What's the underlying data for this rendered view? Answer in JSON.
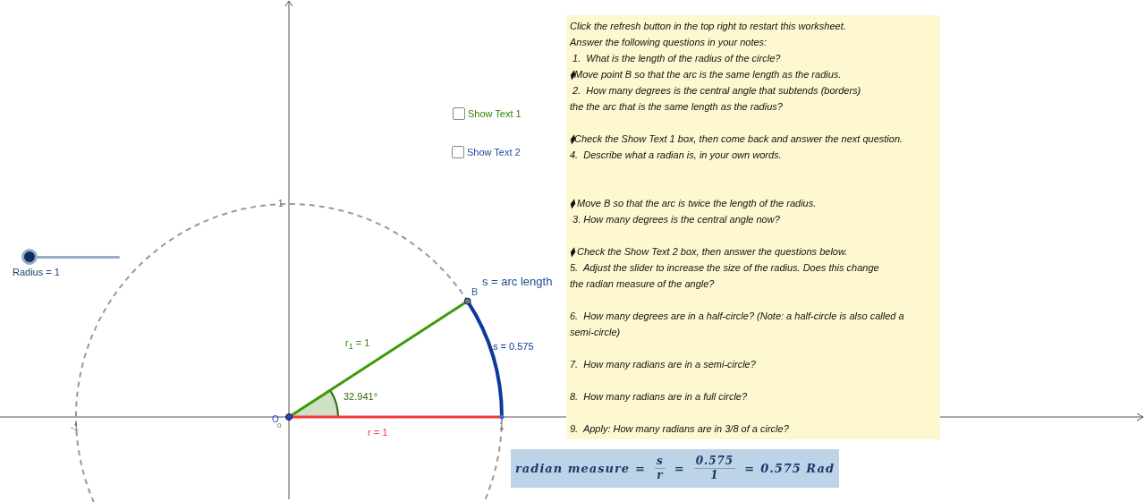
{
  "graphics": {
    "slider": {
      "label": "Radius = 1",
      "level": 0
    },
    "checkboxes": [
      {
        "label": "Show Text 1",
        "checked": false,
        "color": "#2e8500"
      },
      {
        "label": "Show Text 2",
        "checked": false,
        "color": "#1a4a9a"
      }
    ],
    "x_axis_ticks": [
      "-1",
      "0",
      "1"
    ],
    "y_axis_ticks": [
      "1"
    ],
    "point_labels": {
      "origin": "O",
      "b": "B"
    },
    "measure_labels": {
      "arc_caption": "s = arc length",
      "r1": "r$_{1}$ = 1",
      "arc": "s = 0.575",
      "angle": "32.941°",
      "r": "r = 1"
    }
  },
  "worksheet": {
    "paragraphs": [
      [
        "Click the refresh button in the top right to restart this worksheet.",
        "Answer the following questions in your notes:",
        " 1.  What is the length of the radius of the circle?",
        "⧫Move point B so that the arc is the same length as the radius.",
        " 2.  How many degrees is the central angle that subtends (borders)",
        "the the arc that is the same length as the radius?"
      ],
      [
        "⧫Check the Show Text 1 box, then come back and answer the next question.",
        "4.  Describe what a radian is, in your own words."
      ],
      [
        "⧫ Move B so that the arc is twice the length of the radius.",
        " 3. How many degrees is the central angle now?"
      ],
      [
        "⧫ Check the Show Text 2 box, then answer the questions below.",
        "5.  Adjust the slider to increase the size of the radius. Does this change",
        "the radian measure of the angle?"
      ],
      [
        "6.  How many degrees are in a half-circle? (Note: a half-circle is also called a",
        "semi-circle)"
      ],
      [
        "7.  How many radians are in a semi-circle?"
      ],
      [
        "8.  How many radians are in a full circle?"
      ],
      [
        "9.  Apply: How many radians are in 3/8 of a circle?"
      ]
    ]
  },
  "formula": {
    "parts": [
      {
        "kind": "text",
        "text": "radian measure"
      },
      {
        "kind": "op",
        "text": "="
      },
      {
        "kind": "fraction",
        "num": "s",
        "den": "r"
      },
      {
        "kind": "op",
        "text": "="
      },
      {
        "kind": "fraction",
        "num": "0.575",
        "den": "1"
      },
      {
        "kind": "op",
        "text": "="
      },
      {
        "kind": "text",
        "text": "0.575 Rad"
      }
    ]
  }
}
